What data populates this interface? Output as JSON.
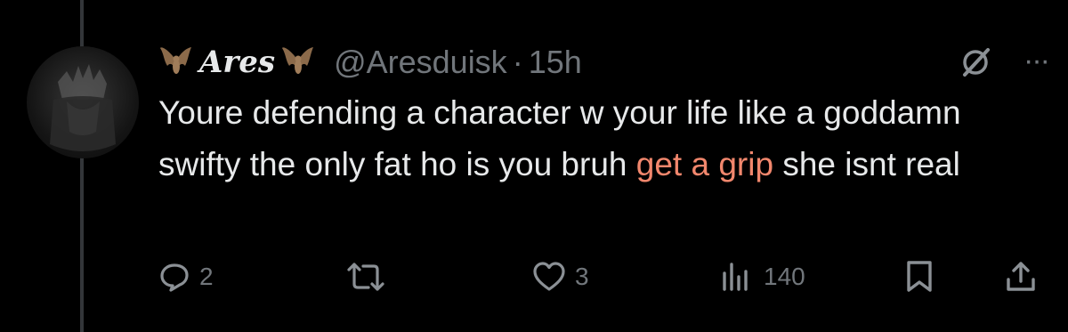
{
  "tweet": {
    "display_name": "Ares",
    "handle": "@Aresduisk",
    "separator": "·",
    "time": "15h",
    "more_label": "···",
    "text_before": "Youre defending a character w your life like a goddamn swifty the only fat ho is you bruh ",
    "text_highlight": "get a grip",
    "text_after": " she isnt real"
  },
  "actions": {
    "replies": "2",
    "retweets": "",
    "likes": "3",
    "views": "140"
  },
  "colors": {
    "background": "#000000",
    "text": "#e7e9ea",
    "muted": "#71767b",
    "highlight": "#f2876d"
  },
  "icons": [
    "bat-icon",
    "grok-icon",
    "more-icon",
    "reply-icon",
    "retweet-icon",
    "like-icon",
    "views-icon",
    "bookmark-icon",
    "share-icon"
  ]
}
